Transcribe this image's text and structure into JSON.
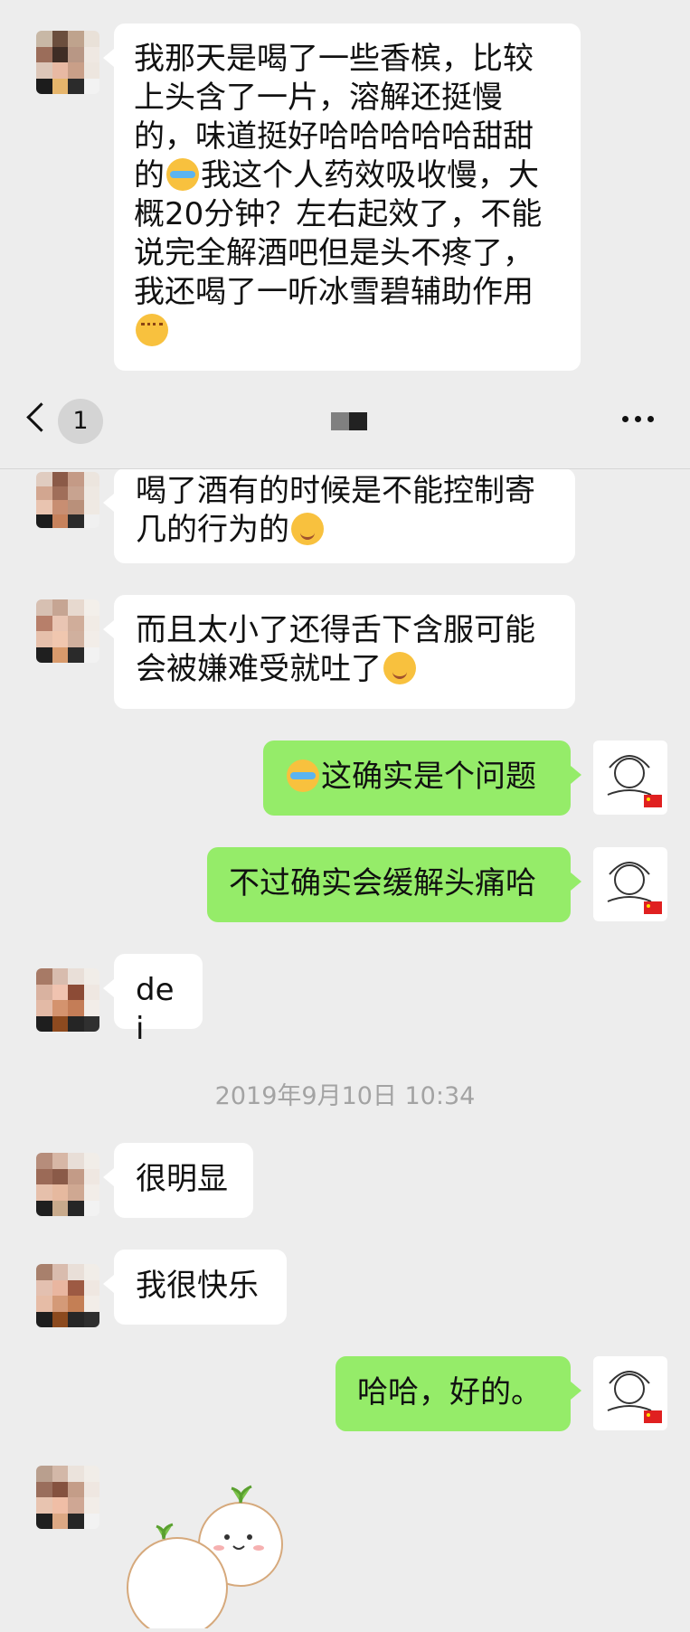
{
  "nav": {
    "badge_count": "1"
  },
  "messages": {
    "m1": {
      "text": "我那天是喝了一些香槟，比较上头含了一片，溶解还挺慢的，味道挺好哈哈哈哈哈甜甜的",
      "text2": "我这个人药效吸收慢，大概20分钟？左右起效了，不能说完全解酒吧但是头不疼了，我还喝了一听冰雪碧辅助作用"
    },
    "m2": {
      "text": "喝了酒有的时候是不能控制寄几的行为的"
    },
    "m3": {
      "text": "而且太小了还得舌下含服可能会被嫌难受就吐了"
    },
    "m4": {
      "text": "这确实是个问题"
    },
    "m5": {
      "text": "不过确实会缓解头痛哈"
    },
    "m6": {
      "text": "dei"
    },
    "m7": {
      "text": "很明显"
    },
    "m8": {
      "text": "我很快乐"
    },
    "m9": {
      "text": "哈哈，好的。"
    }
  },
  "timestamp": "2019年9月10日 10:34",
  "icons": {
    "back": "chevron-left-icon",
    "more": "more-dots-icon",
    "emoji_cry": "laugh-cry-emoji-icon",
    "emoji_smile": "smile-emoji-icon",
    "emoji_shy": "shy-emoji-icon"
  },
  "colors": {
    "background": "#ededed",
    "bubble_other": "#ffffff",
    "bubble_me": "#95ec69",
    "timestamp": "#a3a3a3"
  }
}
